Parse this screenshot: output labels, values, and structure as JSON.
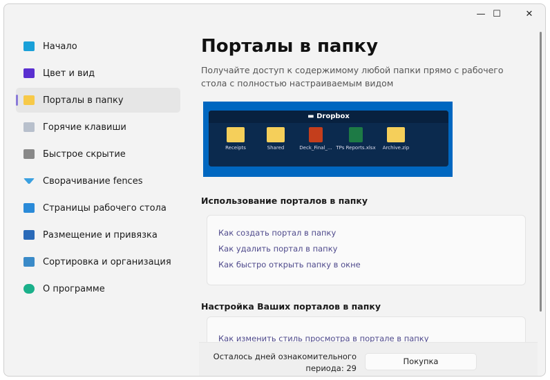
{
  "window": {
    "minimize": "—",
    "maximize": "☐",
    "close": "✕"
  },
  "sidebar": {
    "items": [
      {
        "label": "Начало",
        "icon": "monitor-icon",
        "color": "#1aa0d8"
      },
      {
        "label": "Цвет и вид",
        "icon": "palette-icon",
        "color": "#5a2fd0"
      },
      {
        "label": "Порталы в папку",
        "icon": "folder-icon",
        "color": "#f7c948",
        "selected": true
      },
      {
        "label": "Горячие клавиши",
        "icon": "keyboard-icon",
        "color": "#b8c0cc"
      },
      {
        "label": "Быстрое скрытие",
        "icon": "quick-hide-icon",
        "color": "#888888"
      },
      {
        "label": "Сворачивание fences",
        "icon": "chevron-down-icon",
        "color": "#3aa0e0"
      },
      {
        "label": "Страницы рабочего стола",
        "icon": "pages-icon",
        "color": "#2a8ad8"
      },
      {
        "label": "Размещение и привязка",
        "icon": "layout-icon",
        "color": "#2a6ab8"
      },
      {
        "label": "Сортировка и организация",
        "icon": "filter-icon",
        "color": "#3a8ac8"
      },
      {
        "label": "О программе",
        "icon": "person-icon",
        "color": "#1ab08a"
      }
    ]
  },
  "main": {
    "title": "Порталы в папку",
    "subtitle": "Получайте доступ к содержимому любой папки прямо с рабочего стола с полностью настраиваемым видом",
    "preview": {
      "fence_title": "Dropbox",
      "items": [
        {
          "label": "Receipts",
          "color": "#f5cf5a"
        },
        {
          "label": "Shared",
          "color": "#f5cf5a"
        },
        {
          "label": "Deck_Final_...",
          "color": "#c43e1c"
        },
        {
          "label": "TPs Reports.xlsx",
          "color": "#1d7a45"
        },
        {
          "label": "Archive.zip",
          "color": "#f5cf5a"
        }
      ]
    },
    "section1": {
      "title": "Использование порталов в папку",
      "links": [
        "Как создать портал в папку",
        "Как удалить портал в папку",
        "Как быстро открыть папку в окне"
      ]
    },
    "section2": {
      "title": "Настройка Ваших порталов в папку",
      "links": [
        "Как изменить стиль просмотра в портале в папку"
      ]
    }
  },
  "footer": {
    "trial_text": "Осталось дней ознакомительного периода: 29",
    "buy_label": "Покупка"
  }
}
